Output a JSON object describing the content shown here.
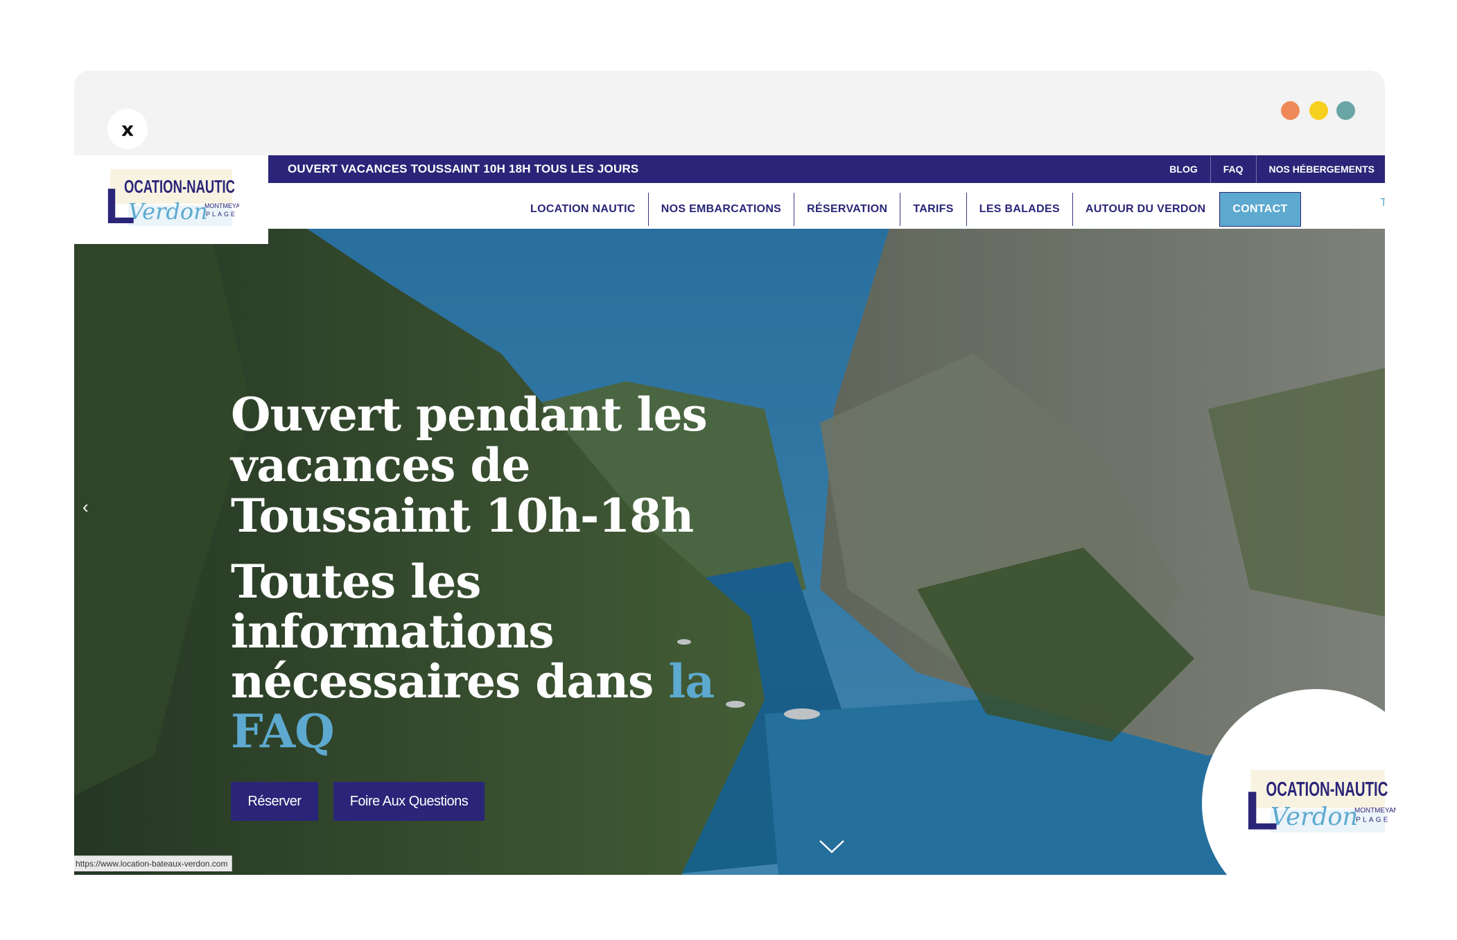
{
  "browser": {
    "close_label": "x",
    "dots": [
      "#f0895a",
      "#f7cf1f",
      "#6aa5a6"
    ]
  },
  "topbar": {
    "message": "OUVERT VACANCES TOUSSAINT 10H 18H TOUS LES JOURS",
    "links": [
      "BLOG",
      "FAQ",
      "NOS HÉBERGEMENTS"
    ]
  },
  "nav": {
    "items": [
      "LOCATION NAUTIC",
      "NOS EMBARCATIONS",
      "RÉSERVATION",
      "TARIFS",
      "LES BALADES",
      "AUTOUR DU VERDON"
    ],
    "contact": "CONTACT",
    "stray": "T"
  },
  "logo": {
    "letter": "L",
    "line1": "OCATION-NAUTIC",
    "script": "Verdon",
    "small1": "MONTMEYAN",
    "small2": "PLAGE"
  },
  "hero": {
    "heading": "Ouvert pendant les vacances de Toussaint 10h-18h",
    "sub_text": "Toutes les informations nécessaires dans ",
    "sub_link": "la FAQ",
    "btn_reserve": "Réserver",
    "btn_faq": "Foire Aux Questions",
    "arrow_left": "‹"
  },
  "status_url": "https://www.location-bateaux-verdon.com",
  "colors": {
    "navy": "#2a2578",
    "accent": "#5da9cf"
  }
}
